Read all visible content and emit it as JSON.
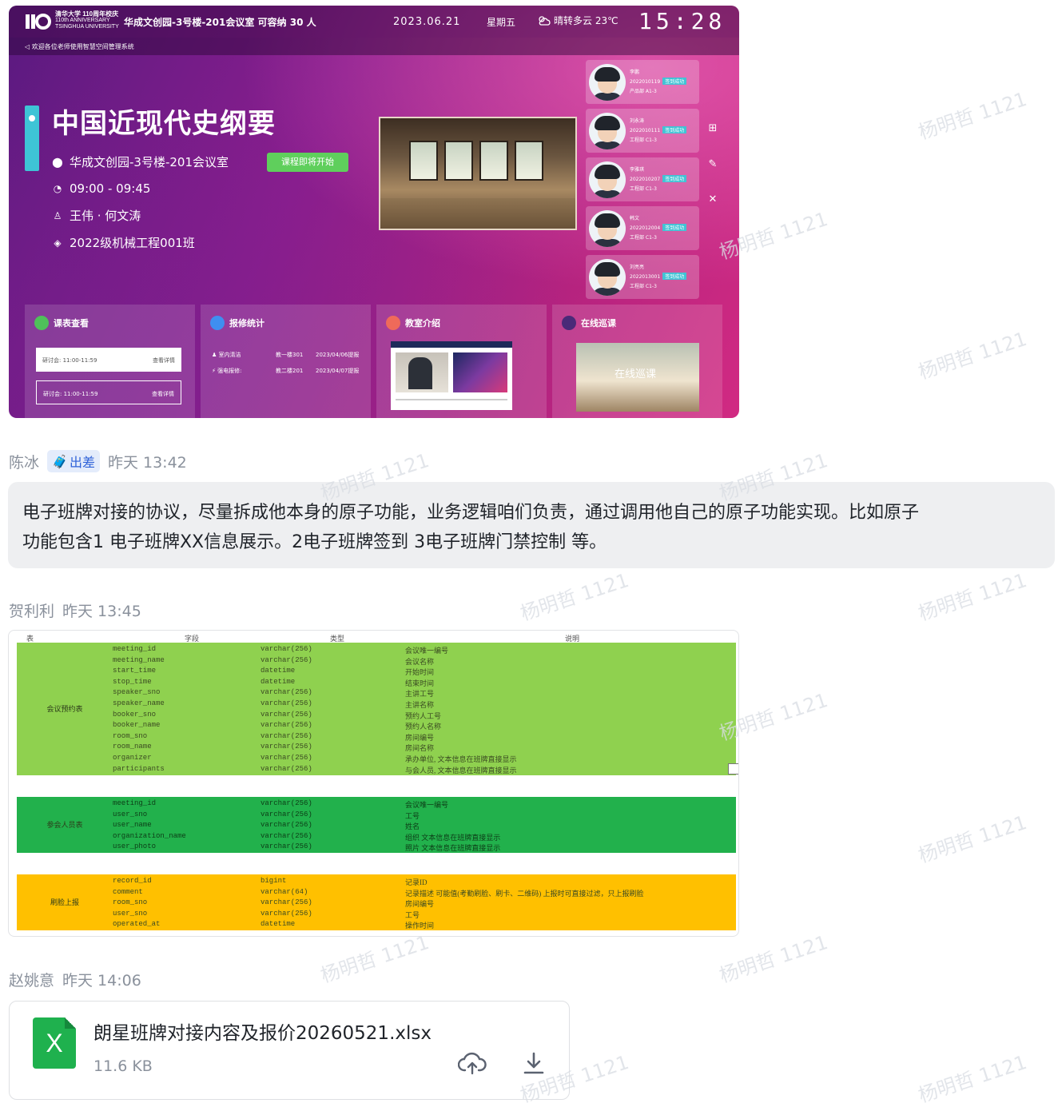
{
  "sign": {
    "logo_text": [
      "清华大学 110周年校庆",
      "110th ANNIVERSARY",
      "TSINGHUA UNIVERSITY"
    ],
    "room_header": "华成文创园-3号楼-201会议室  可容纳 30 人",
    "date": "2023.06.21",
    "weekday": "星期五",
    "weather": "晴转多云  23℃",
    "time": "15:28",
    "marquee": "欢迎各位老师使用智慧空间管理系统",
    "course_title": "中国近现代史纲要",
    "location": "华成文创园-3号楼-201会议室",
    "status": "课程即将开始",
    "hours": "09:00 - 09:45",
    "teachers": "王伟 · 何文涛",
    "class": "2022级机械工程001班",
    "attendees": [
      {
        "name": "李鹏",
        "id": "2022010119",
        "status": "签到成功",
        "dept": "产品部  A1-3"
      },
      {
        "name": "刘永涛",
        "id": "2022010111",
        "status": "签到成功",
        "dept": "工程部  C1-3"
      },
      {
        "name": "李雅琪",
        "id": "2022010207",
        "status": "签到成功",
        "dept": "工程部  C1-3"
      },
      {
        "name": "韩文",
        "id": "2022012004",
        "status": "签到成功",
        "dept": "工程部  C1-3"
      },
      {
        "name": "刘亮亮",
        "id": "2022013001",
        "status": "签到成功",
        "dept": "工程部  C1-3"
      }
    ],
    "panels": {
      "schedule": {
        "title": "课表查看",
        "rows": [
          {
            "label": "研讨会: 11:00-11:59",
            "action": "查看详情"
          },
          {
            "label": "研讨会: 11:00-11:59",
            "action": "查看详情"
          }
        ]
      },
      "repair": {
        "title": "报修统计",
        "rows": [
          {
            "type": "室内清洁",
            "room": "教一楼301",
            "date": "2023/04/06提报"
          },
          {
            "type": "强电报修:",
            "room": "教二楼201",
            "date": "2023/04/07提报"
          }
        ]
      },
      "intro": {
        "title": "教室介绍"
      },
      "patrol": {
        "title": "在线巡课",
        "overlay": "在线巡课"
      }
    },
    "side_tools": [
      "apps-icon",
      "edit-icon",
      "tools-icon"
    ]
  },
  "messages": [
    {
      "sender": "陈冰",
      "tag": "出差",
      "time": "昨天 13:42",
      "text_1": "电子班牌对接的协议，尽量拆成他本身的原子功能，业务逻辑咱们负责，通过调用他自己的原子功能实现。比如原子",
      "text_2": "功能包含1 电子班牌XX信息展示。2电子班牌签到 3电子班牌门禁控制 等。"
    },
    {
      "sender": "贺利利",
      "time": "昨天 13:45"
    },
    {
      "sender": "赵姚意",
      "time": "昨天 14:06"
    }
  ],
  "sheet": {
    "headers": [
      "表",
      "字段",
      "类型",
      "说明"
    ],
    "blocks": [
      {
        "name": "会议预约表",
        "color": "#8fd14f",
        "rows": [
          [
            "meeting_id",
            "varchar(256)",
            "会议唯一编号"
          ],
          [
            "meeting_name",
            "varchar(256)",
            "会议名称"
          ],
          [
            "start_time",
            "datetime",
            "开始时间"
          ],
          [
            "stop_time",
            "datetime",
            "结束时间"
          ],
          [
            "speaker_sno",
            "varchar(256)",
            "主讲工号"
          ],
          [
            "speaker_name",
            "varchar(256)",
            "主讲名称"
          ],
          [
            "booker_sno",
            "varchar(256)",
            "预约人工号"
          ],
          [
            "booker_name",
            "varchar(256)",
            "预约人名称"
          ],
          [
            "room_sno",
            "varchar(256)",
            "房间编号"
          ],
          [
            "room_name",
            "varchar(256)",
            "房间名称"
          ],
          [
            "organizer",
            "varchar(256)",
            "承办单位, 文本信息在班牌直接显示"
          ],
          [
            "participants",
            "varchar(256)",
            "与会人员, 文本信息在班牌直接显示"
          ]
        ]
      },
      {
        "name": "参会人员表",
        "color": "#22b14c",
        "rows": [
          [
            "meeting_id",
            "varchar(256)",
            "会议唯一编号"
          ],
          [
            "user_sno",
            "varchar(256)",
            "工号"
          ],
          [
            "user_name",
            "varchar(256)",
            "姓名"
          ],
          [
            "organization_name",
            "varchar(256)",
            "组织  文本信息在班牌直接显示"
          ],
          [
            "user_photo",
            "varchar(256)",
            "照片  文本信息在班牌直接显示"
          ]
        ]
      },
      {
        "name": "刷脸上报",
        "color": "#ffc000",
        "rows": [
          [
            "record_id",
            "bigint",
            "记录ID"
          ],
          [
            "comment",
            "varchar(64)",
            "记录描述   可能值(考勤刷脸、刷卡、二维码) 上报时可直接过滤，只上报刷脸"
          ],
          [
            "room_sno",
            "varchar(256)",
            "房间编号"
          ],
          [
            "user_sno",
            "varchar(256)",
            "工号"
          ],
          [
            "operated_at",
            "datetime",
            "操作时间"
          ]
        ]
      }
    ]
  },
  "file": {
    "name": "朗星班牌对接内容及报价20260521.xlsx",
    "size": "11.6 KB",
    "icon_letter": "X"
  },
  "watermark": "杨明哲 1121"
}
